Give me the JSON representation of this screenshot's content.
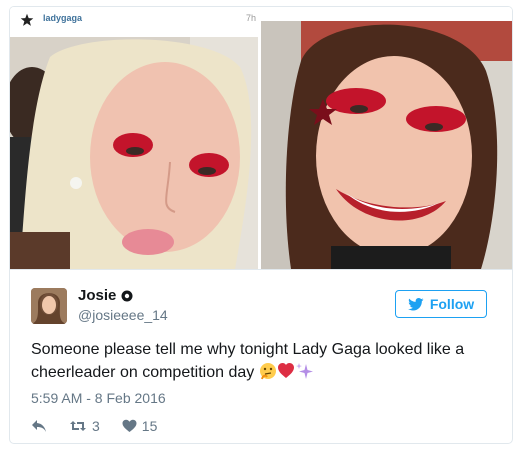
{
  "media": {
    "ig_username": "ladygaga",
    "ig_time": "7h",
    "ig_logo_icon": "instagram-star-logo-icon"
  },
  "tweet": {
    "author_name": "Josie",
    "author_handle": "@josieeee_14",
    "follow_label": "Follow",
    "text": "Someone please tell me why tonight Lady Gaga looked like a cheerleader on competition day",
    "emojis": [
      "thinking-face-icon",
      "red-heart-icon",
      "sparkles-icon"
    ],
    "timestamp": "5:59 AM - 8 Feb 2016",
    "retweet_count": "3",
    "like_count": "15",
    "colors": {
      "twitter_blue": "#1da1f2",
      "secondary_text": "#657786",
      "heart": "#e0245e"
    }
  }
}
